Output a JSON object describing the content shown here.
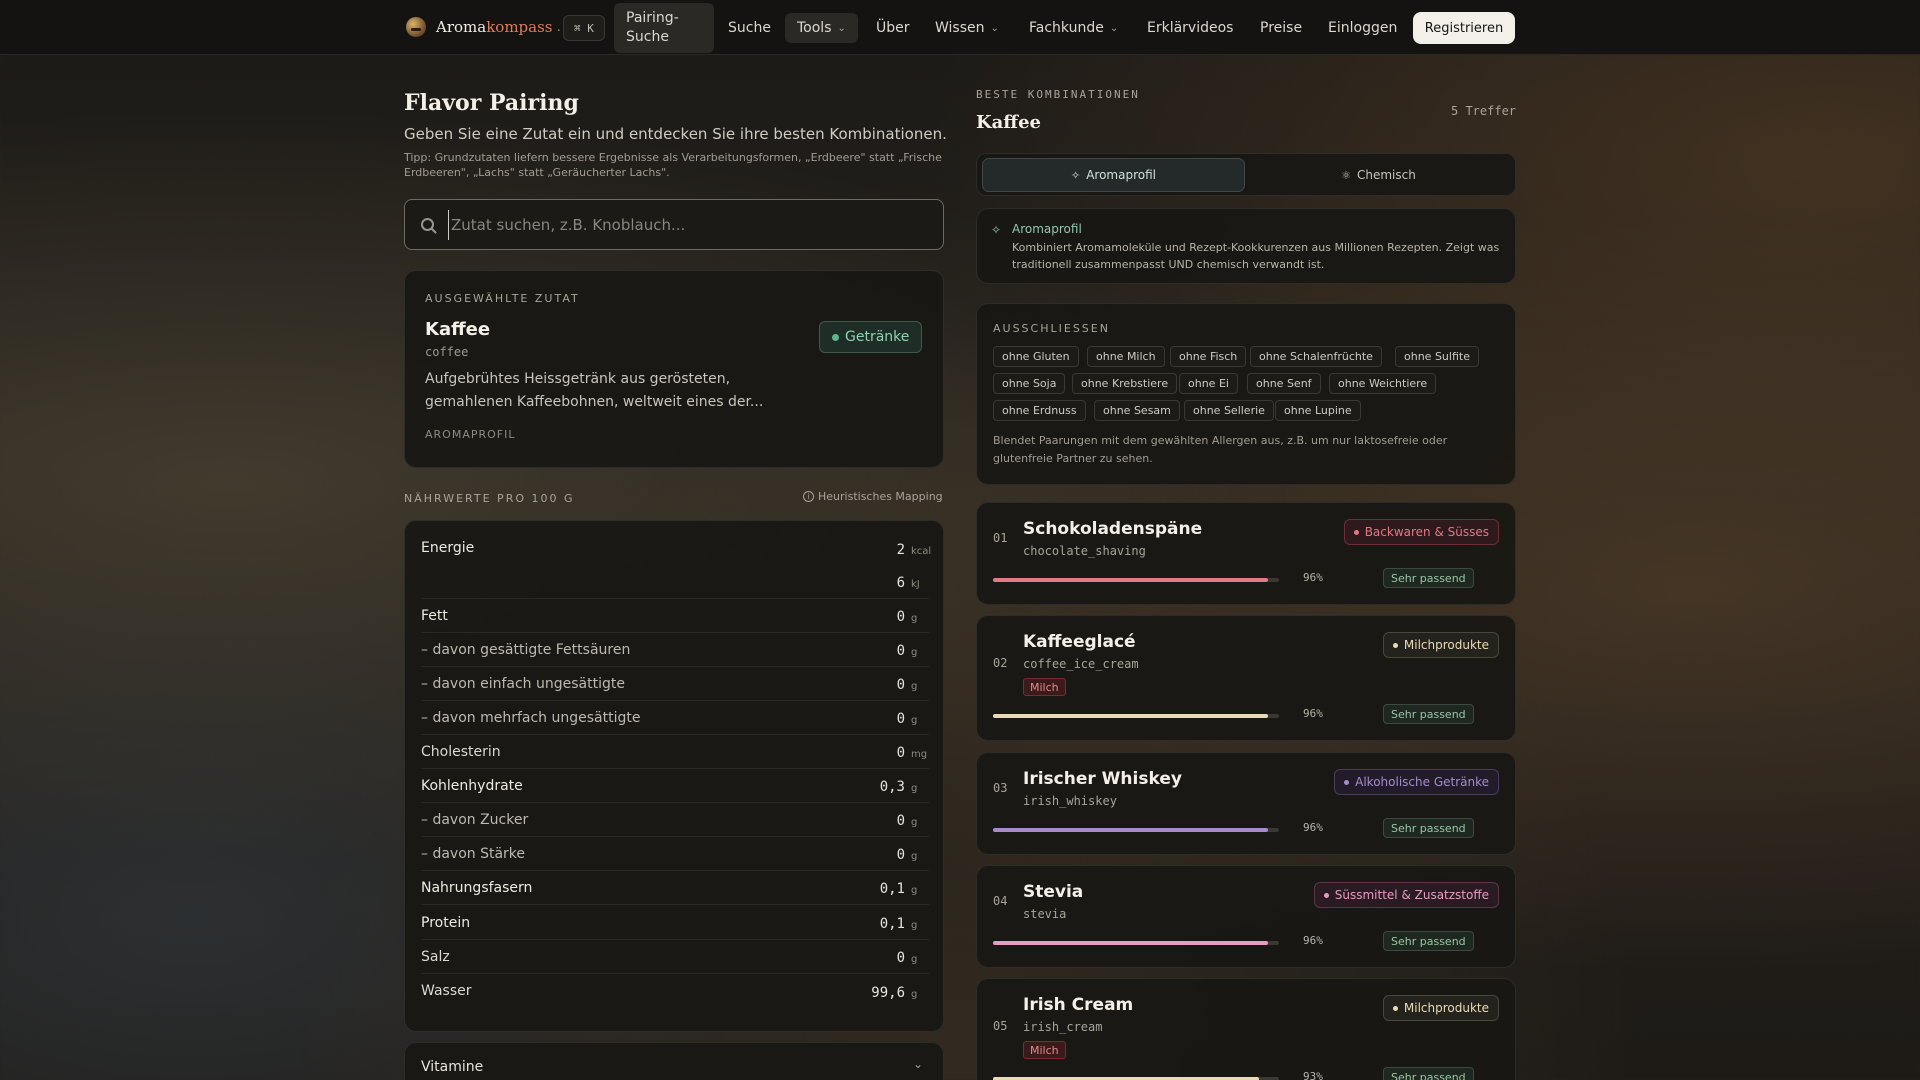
{
  "nav": {
    "brand_main": "Aroma",
    "brand_accent": "kompass",
    "brand_tld": ".ch",
    "shortcut": "⌘ K",
    "items": [
      "Pairing-Suche",
      "Suche",
      "Tools",
      "Über",
      "Wissen",
      "Fachkunde",
      "Erklärvideos",
      "Preise",
      "Einloggen"
    ],
    "register": "Registrieren"
  },
  "left": {
    "title": "Flavor Pairing",
    "subtitle": "Geben Sie eine Zutat ein und entdecken Sie ihre besten Kombinationen.",
    "tip": "Tipp: Grundzutaten liefern bessere Ergebnisse als Verarbeitungsformen, „Erdbeere\" statt „Frische Erdbeeren\", „Lachs\" statt „Geräucherter Lachs\".",
    "search_placeholder": "Zutat suchen, z.B. Knoblauch..."
  },
  "selected": {
    "overline": "Ausgewählte Zutat",
    "name": "Kaffee",
    "code": "coffee",
    "category": "Getränke",
    "description": "Aufgebrühtes Heissgetränk aus gerösteten, gemahlenen Kaffeebohnen, weltweit eines der...",
    "aroma_label": "AROMAPROFIL",
    "category_color": "#8ed0b0"
  },
  "nutrition": {
    "heading": "NÄHRWERTE PRO 100 G",
    "mapping": "Heuristisches Mapping",
    "rows": [
      {
        "label": "Energie",
        "value": "2",
        "unit": "kcal"
      },
      {
        "label": "",
        "value": "6",
        "unit": "kJ"
      },
      {
        "label": "Fett",
        "value": "0",
        "unit": "g"
      },
      {
        "label": "– davon gesättigte Fettsäuren",
        "value": "0",
        "unit": "g"
      },
      {
        "label": "– davon einfach ungesättigte",
        "value": "0",
        "unit": "g"
      },
      {
        "label": "– davon mehrfach ungesättigte",
        "value": "0",
        "unit": "g"
      },
      {
        "label": "Cholesterin",
        "value": "0",
        "unit": "mg"
      },
      {
        "label": "Kohlenhydrate",
        "value": "0,3",
        "unit": "g"
      },
      {
        "label": "– davon Zucker",
        "value": "0",
        "unit": "g"
      },
      {
        "label": "– davon Stärke",
        "value": "0",
        "unit": "g"
      },
      {
        "label": "Nahrungsfasern",
        "value": "0,1",
        "unit": "g"
      },
      {
        "label": "Protein",
        "value": "0,1",
        "unit": "g"
      },
      {
        "label": "Salz",
        "value": "0",
        "unit": "g"
      },
      {
        "label": "Wasser",
        "value": "99,6",
        "unit": "g"
      }
    ],
    "vitamins_label": "Vitamine"
  },
  "right": {
    "overline": "BESTE KOMBINATIONEN",
    "title": "Kaffee",
    "count": "5 Treffer",
    "tab_aroma": "Aromaprofil",
    "tab_chem": "Chemisch",
    "info_title": "Aromaprofil",
    "info_desc": "Kombiniert Aromamoleküle und Rezept-Kookkurenzen aus Millionen Rezepten. Zeigt was traditionell zusammenpasst UND chemisch verwandt ist.",
    "exclude_label": "Ausschliessen",
    "chips": [
      "ohne Gluten",
      "ohne Milch",
      "ohne Fisch",
      "ohne Schalenfrüchte",
      "ohne Sulfite",
      "ohne Soja",
      "ohne Krebstiere",
      "ohne Ei",
      "ohne Senf",
      "ohne Weichtiere",
      "ohne Erdnuss",
      "ohne Sesam",
      "ohne Sellerie",
      "ohne Lupine"
    ],
    "exclude_note": "Blendet Paarungen mit dem gewählten Allergen aus, z.B. um nur laktosefreie oder glutenfreie Partner zu sehen."
  },
  "results": [
    {
      "num": "01",
      "name": "Schokoladenspäne",
      "code": "chocolate_shaving",
      "category": "Backwaren & Süsses",
      "allergen": "",
      "score": 0.96,
      "pct": "96%",
      "fit": "Sehr passend",
      "color": "#e07a85",
      "cat_border": "#6b2f35",
      "cat_bg": "#2e1a1c"
    },
    {
      "num": "02",
      "name": "Kaffeeglacé",
      "code": "coffee_ice_cream",
      "category": "Milchprodukte",
      "allergen": "Milch",
      "score": 0.96,
      "pct": "96%",
      "fit": "Sehr passend",
      "color": "#eadbb8",
      "cat_border": "#4a4638",
      "cat_bg": "#24221c"
    },
    {
      "num": "03",
      "name": "Irischer Whiskey",
      "code": "irish_whiskey",
      "category": "Alkoholische Getränke",
      "allergen": "",
      "score": 0.96,
      "pct": "96%",
      "fit": "Sehr passend",
      "color": "#a88bc9",
      "cat_border": "#4a3a5c",
      "cat_bg": "#221c2a"
    },
    {
      "num": "04",
      "name": "Stevia",
      "code": "stevia",
      "category": "Süssmittel & Zusatzstoffe",
      "allergen": "",
      "score": 0.96,
      "pct": "96%",
      "fit": "Sehr passend",
      "color": "#e89cc4",
      "cat_border": "#5c3448",
      "cat_bg": "#2a1a22"
    },
    {
      "num": "05",
      "name": "Irish Cream",
      "code": "irish_cream",
      "category": "Milchprodukte",
      "allergen": "Milch",
      "score": 0.93,
      "pct": "93%",
      "fit": "Sehr passend",
      "color": "#eadbb8",
      "cat_border": "#4a4638",
      "cat_bg": "#24221c"
    }
  ]
}
